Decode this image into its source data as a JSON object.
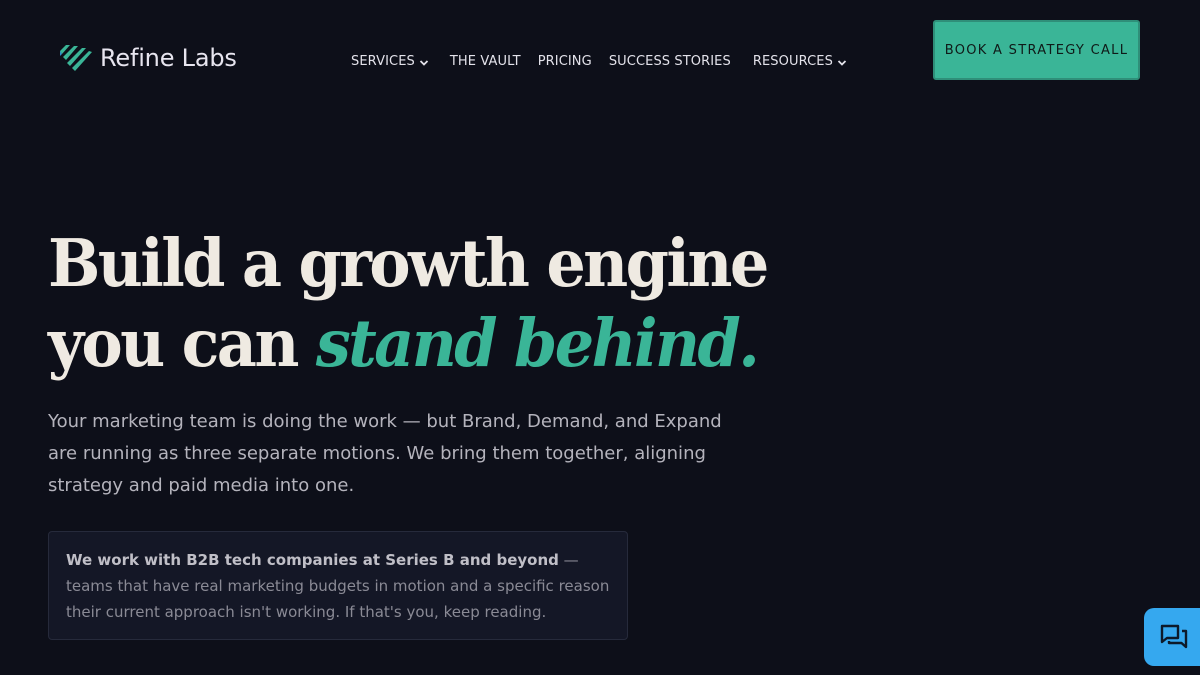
{
  "brand": {
    "name": "Refine Labs",
    "accent_color": "#3ab597",
    "background_color": "#0d0f19"
  },
  "nav": {
    "items": [
      {
        "label": "SERVICES",
        "has_dropdown": true
      },
      {
        "label": "THE VAULT",
        "has_dropdown": false
      },
      {
        "label": "PRICING",
        "has_dropdown": false
      },
      {
        "label": "SUCCESS STORIES",
        "has_dropdown": false
      },
      {
        "label": "RESOURCES",
        "has_dropdown": true
      }
    ],
    "cta_label": "BOOK A STRATEGY CALL"
  },
  "hero": {
    "headline_line1": "Build a growth engine",
    "headline_line2_plain": "you can ",
    "headline_line2_accent": "stand behind.",
    "subcopy": "Your marketing team is doing the work — but Brand, Demand, and Expand are running as three separate motions. We bring them together, aligning strategy and paid media into one.",
    "notice_strong": "We work with B2B tech companies at Series B and beyond",
    "notice_rest": " — teams that have real marketing budgets in motion and a specific reason their current approach isn't working. If that's you, keep reading."
  },
  "chat_widget": {
    "icon": "chat-bubbles-icon",
    "color": "#35a8ef"
  }
}
